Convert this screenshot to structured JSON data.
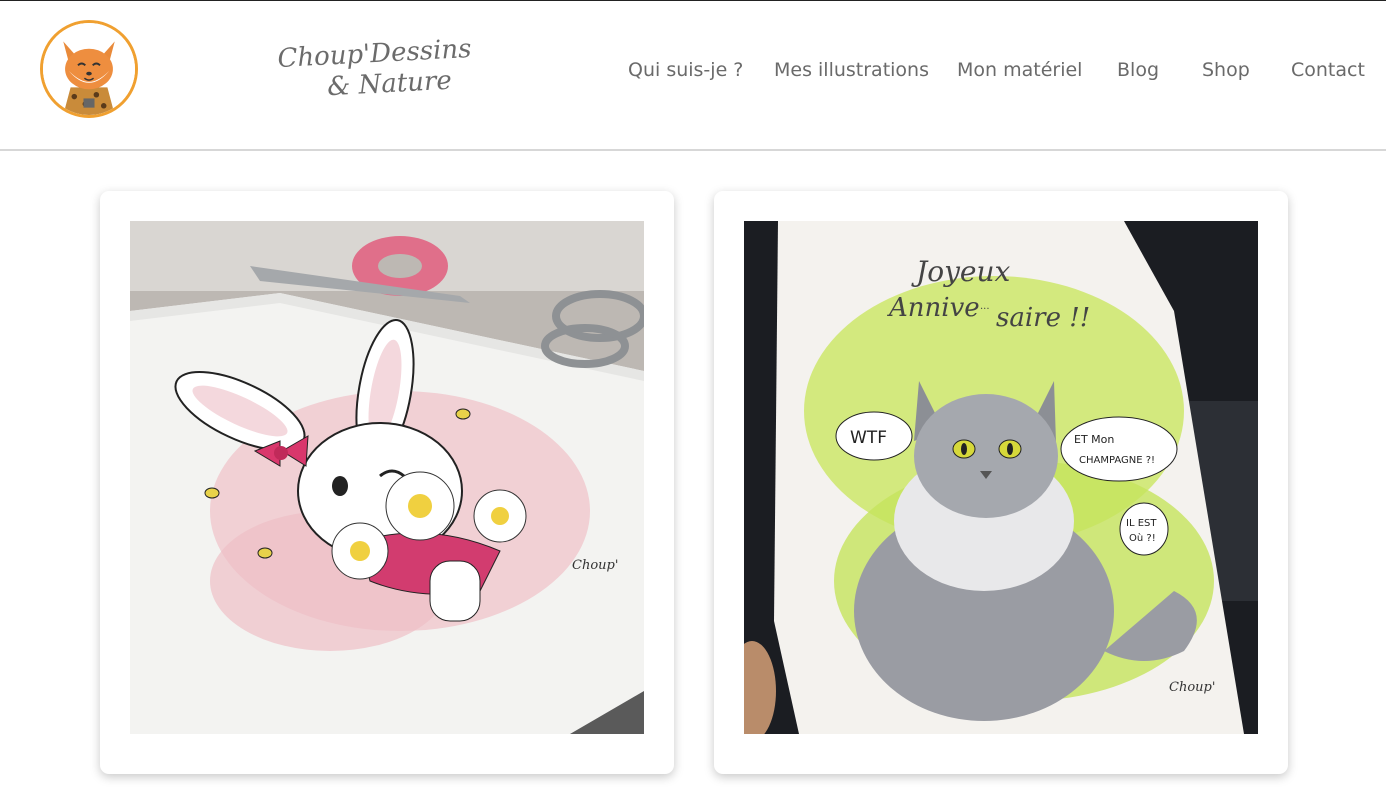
{
  "brand": {
    "name_line1": "Choup'Dessins",
    "name_line2": "& Nature",
    "logo_icon": "fox-mascot-icon"
  },
  "nav": {
    "items": [
      {
        "label": "Qui suis-je ?"
      },
      {
        "label": "Mes illustrations"
      },
      {
        "label": "Mon matériel"
      },
      {
        "label": "Blog"
      },
      {
        "label": "Shop"
      },
      {
        "label": "Contact"
      }
    ]
  },
  "gallery": {
    "card1": {
      "signature": "Choup'"
    },
    "card2": {
      "greeting_line1": "Joyeux",
      "greeting_line2": "Annive",
      "greeting_small": "...",
      "greeting_line3": "saire !!",
      "bubble_left": "WTF",
      "bubble_right_1": "ET Mon",
      "bubble_right_2": "CHAMPAGNE ?!",
      "bubble_small_1": "IL EST",
      "bubble_small_2": "Où ?!",
      "signature": "Choup'"
    }
  },
  "colors": {
    "nav_text": "#6a6a6a",
    "logo_ring": "#f0a030",
    "header_border": "#d7d7d7"
  }
}
